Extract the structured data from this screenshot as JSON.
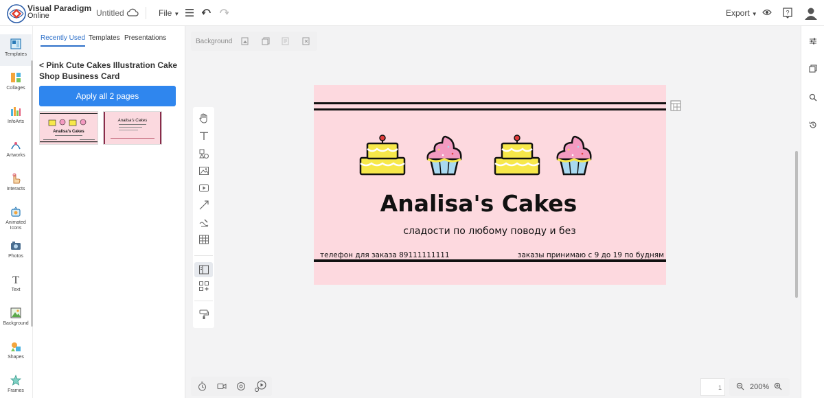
{
  "app": {
    "brand_line1": "Visual Paradigm",
    "brand_line2": "Online",
    "doc_title": "Untitled",
    "file_menu": "File",
    "export_menu": "Export"
  },
  "rail": {
    "items": [
      {
        "label": "Templates",
        "icon": "templates-icon"
      },
      {
        "label": "Collages",
        "icon": "collages-icon"
      },
      {
        "label": "InfoArts",
        "icon": "infoarts-icon"
      },
      {
        "label": "Artworks",
        "icon": "artworks-icon"
      },
      {
        "label": "Interacts",
        "icon": "interacts-icon"
      },
      {
        "label": "Animated Icons",
        "icon": "animated-icons-icon"
      },
      {
        "label": "Photos",
        "icon": "photos-icon"
      },
      {
        "label": "Text",
        "icon": "text-icon"
      },
      {
        "label": "Background",
        "icon": "background-icon"
      },
      {
        "label": "Shapes",
        "icon": "shapes-icon"
      },
      {
        "label": "Frames",
        "icon": "frames-icon"
      }
    ]
  },
  "panel": {
    "tabs": [
      "Recently Used",
      "Templates",
      "Presentations"
    ],
    "back_title": "< Pink Cute Cakes Illustration Cake Shop Business Card",
    "apply_button": "Apply all 2 pages",
    "thumb1_title": "Analisa's Cakes",
    "thumb2_title": "Analisa's Cakes"
  },
  "canvas_toolbar": {
    "background_label": "Background"
  },
  "card": {
    "title": "Analisa's Cakes",
    "subtitle": "сладости по любому поводу и без",
    "phone_text": "телефон для заказа 89111111111",
    "hours_text": "заказы принимаю с 9 до 19 по будням"
  },
  "zoom": {
    "level": "200%"
  },
  "colors": {
    "accent": "#2f86ee",
    "card_bg": "#fdd9df",
    "cake_yellow": "#f7e84a",
    "frosting_pink": "#f39ac0",
    "cup_blue": "#a9d9f0"
  }
}
